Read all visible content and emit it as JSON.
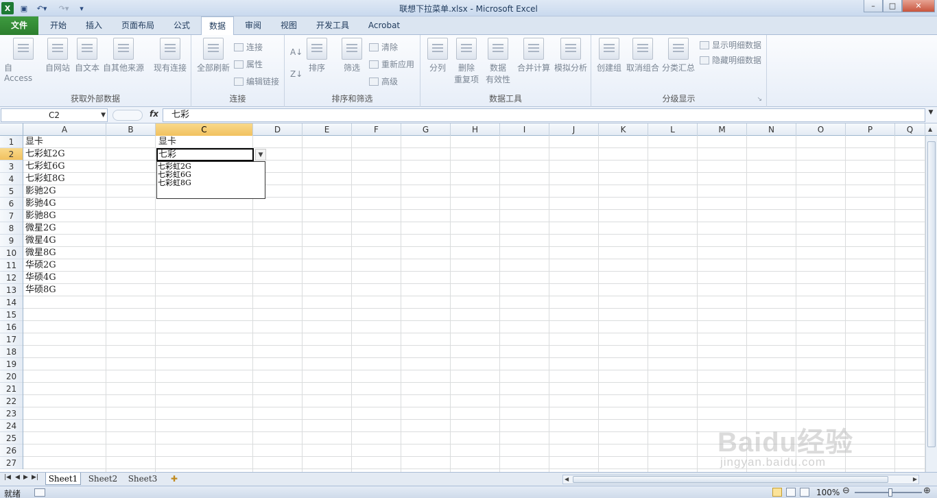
{
  "window": {
    "title": "联想下拉菜单.xlsx - Microsoft Excel",
    "min": "–",
    "max": "□",
    "close": "✕"
  },
  "ribbon_tabs": [
    {
      "label": "文件"
    },
    {
      "label": "开始"
    },
    {
      "label": "插入"
    },
    {
      "label": "页面布局"
    },
    {
      "label": "公式"
    },
    {
      "label": "数据"
    },
    {
      "label": "审阅"
    },
    {
      "label": "视图"
    },
    {
      "label": "开发工具"
    },
    {
      "label": "Acrobat"
    }
  ],
  "ribbon": {
    "external": {
      "label": "获取外部数据",
      "access": "自 Access",
      "web": "自网站",
      "text": "自文本",
      "other": "自其他来源",
      "existing": "现有连接"
    },
    "connections": {
      "label": "连接",
      "refresh": "全部刷新",
      "conn": "连接",
      "props": "属性",
      "edit": "编辑链接"
    },
    "sortfilter": {
      "label": "排序和筛选",
      "sort": "排序",
      "filter": "筛选",
      "clear": "清除",
      "reapply": "重新应用",
      "advanced": "高级"
    },
    "datatools": {
      "label": "数据工具",
      "split": "分列",
      "dedupe1": "删除",
      "dedupe2": "重复项",
      "valid1": "数据",
      "valid2": "有效性",
      "consolidate": "合并计算",
      "whatif": "模拟分析"
    },
    "outline": {
      "label": "分级显示",
      "group": "创建组",
      "ungroup": "取消组合",
      "subtotal": "分类汇总",
      "show": "显示明细数据",
      "hide": "隐藏明细数据"
    }
  },
  "formula_bar": {
    "name_box": "C2",
    "fx": "fx",
    "formula": "七彩"
  },
  "columns": [
    "A",
    "B",
    "C",
    "D",
    "E",
    "F",
    "G",
    "H",
    "I",
    "J",
    "K",
    "L",
    "M",
    "N",
    "O",
    "P",
    "Q"
  ],
  "rows": [
    "1",
    "2",
    "3",
    "4",
    "5",
    "6",
    "7",
    "8",
    "9",
    "10",
    "11",
    "12",
    "13",
    "14",
    "15",
    "16",
    "17",
    "18",
    "19",
    "20",
    "21",
    "22",
    "23",
    "24",
    "25",
    "26",
    "27"
  ],
  "cells_a": [
    "显卡",
    "七彩虹2G",
    "七彩虹6G",
    "七彩虹8G",
    "影驰2G",
    "影驰4G",
    "影驰8G",
    "微星2G",
    "微星4G",
    "微星8G",
    "华硕2G",
    "华硕4G",
    "华硕8G"
  ],
  "cell_c1": "显卡",
  "active_cell_value": "七彩",
  "dropdown_options": [
    "七彩虹2G",
    "七彩虹6G",
    "七彩虹8G"
  ],
  "sheets": [
    "Sheet1",
    "Sheet2",
    "Sheet3"
  ],
  "status": {
    "mode": "就绪",
    "zoom": "100%"
  },
  "watermark": {
    "logo": "Baidu经验",
    "url": "jingyan.baidu.com"
  }
}
